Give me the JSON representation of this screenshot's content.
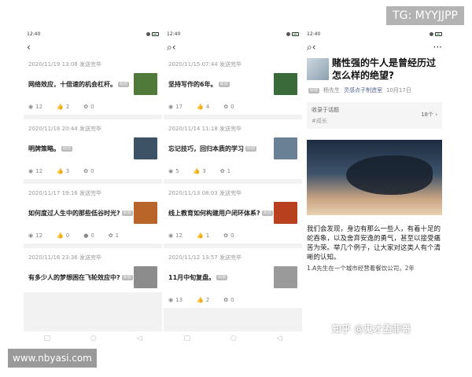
{
  "status_time": "12:40",
  "nav": {
    "back_icon": "chevron-left-icon",
    "search_icon": "search-icon",
    "more_label": "···"
  },
  "panel1": {
    "cards": [
      {
        "meta": "2020/11/19 13:08 发送完毕",
        "title": "网络效应，十倍速的机会杠杆。",
        "tag": "原创",
        "views": "12",
        "likes": "2",
        "shares": "0",
        "thumb_color": "#4f7a3a"
      },
      {
        "meta": "2020/11/18 20:44 发送完毕",
        "title": "明牌策略。",
        "tag": "原创",
        "views": "12",
        "likes": "3",
        "shares": "0",
        "thumb_color": "#3d5265"
      },
      {
        "meta": "2020/11/17 19:16 发送完毕",
        "title": "如何度过人生中的那些低谷时光?",
        "tag": "原创",
        "views": "12",
        "likes": "0",
        "shares": "1",
        "extra": "0",
        "thumb_color": "#b9652a"
      },
      {
        "meta": "2020/11/16 23:36 发送完毕",
        "title": "有多少人的梦想困在飞轮效应中?",
        "tag": "原创",
        "thumb_color": "#8c8c8c"
      }
    ]
  },
  "panel2": {
    "cards": [
      {
        "meta": "2020/11/15 07:44 发送完毕",
        "title": "坚持写作的6年。",
        "tag": "原创",
        "views": "17",
        "likes": "4",
        "shares": "0",
        "thumb_color": "#3b6a3a"
      },
      {
        "meta": "2020/11/14 11:18 发送完毕",
        "title": "忘记技巧，回归本质的学习",
        "tag": "原创",
        "views": "5",
        "likes": "3",
        "shares": "1",
        "thumb_color": "#6a8195"
      },
      {
        "meta": "2020/11/13 08:03 发送完毕",
        "title": "线上教育如何构建用户闭环体系?",
        "tag": "原创",
        "views": "12",
        "likes": "1",
        "shares": "0",
        "thumb_color": "#b8401e"
      },
      {
        "meta": "2020/11/12 13:57 发送完毕",
        "title": "11月中旬复盘。",
        "tag": "原创",
        "views": "13",
        "likes": "2",
        "shares": "0",
        "thumb_color": "#9a9a9a"
      }
    ]
  },
  "panel3": {
    "title": "赌性强的牛人是曾经历过怎么样的绝望?",
    "byline": {
      "tag": "原创",
      "author": "杨先生",
      "account": "灵感点子制造室",
      "date": "10月17日"
    },
    "collection": {
      "label": "收录于话题",
      "topic": "#成长",
      "count": "18个 ›"
    },
    "paragraphs": [
      "我们会发现，身边有那么一些人，有着十足的蛇吞象，以及舍弃安逸的勇气，甚至以接受痛苦为荣。举几个例子，让大家对这类人有个清晰的认知。",
      "1.A先生在一个城市经营着餐饮公司，2年"
    ]
  },
  "softkeys": [
    "□",
    "○",
    "◁"
  ],
  "watermarks": {
    "tg": "TG: MYYJJPP",
    "site": "www.nbyasi.com",
    "zhihu": "知乎 @鬼才孟菲哥"
  }
}
